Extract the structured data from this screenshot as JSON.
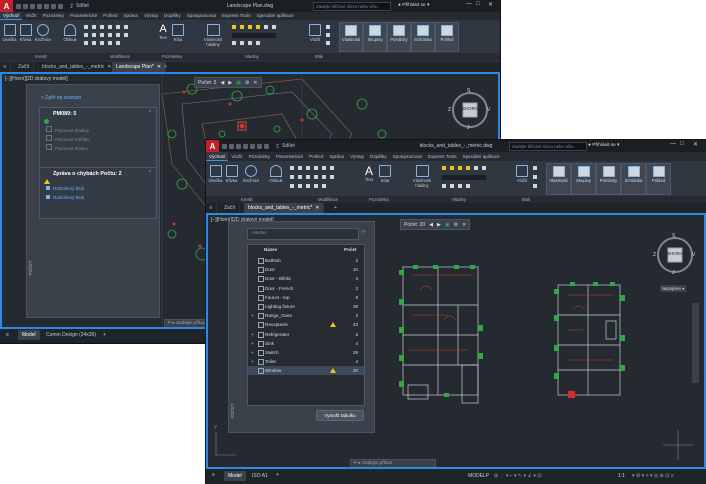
{
  "back_window": {
    "doc_title": "Landscape Plan.dwg",
    "share_label": "Sdílet",
    "search_placeholder": "Zadejte klíčové slovo nebo větu",
    "login_label": "Přihlásit se",
    "menu": [
      "Výchozí",
      "Vložit",
      "Poznámky",
      "Parametrické",
      "Pohled",
      "Správa",
      "Výstup",
      "Doplňky",
      "Spolupracovat",
      "Express Tools",
      "Speciální aplikace"
    ],
    "ribbon_tools": [
      "Úsečka",
      "Křivka",
      "Kružnice",
      "Oblouk",
      "Text",
      "Kóta",
      "Vlastnosti hladiny",
      "Vložit",
      "Vlastnosti",
      "Skupiny",
      "Pomůcky",
      "Schránka",
      "Pohled"
    ],
    "panel_labels": [
      "Kreslit",
      "Modifikace",
      "Poznámka",
      "Hladiny",
      "Blok"
    ],
    "tabs": [
      "Začít",
      "blocks_and_tables_-_metric",
      "Landscape Plan*"
    ],
    "viewport_label": "[−][Horní][2D drátový model]",
    "count_label": "Počet: 5",
    "viewcube": {
      "face": "SHORA",
      "s": "S",
      "j": "J",
      "z": "Z",
      "v": "V"
    },
    "count_palette": {
      "back": "< Zpět na seznam",
      "block_name": "PM089: 5",
      "options": [
        "Parovnat hladiny",
        "Parovnat měřítko",
        "Parovnat Rotaci"
      ],
      "error_title": "Zpráva o chybách Počtu: 2",
      "errors": [
        "Rozložený blok",
        "Rozložený blok"
      ],
      "side_label": "POČET"
    },
    "status": {
      "model_tab": "Model",
      "layout_tab": "Comm Design (24x36)"
    },
    "cmd_placeholder": "Zadejte příkaz"
  },
  "front_window": {
    "doc_title": "blocks_and_tables_-_metric.dwg",
    "share_label": "Sdílet",
    "search_placeholder": "Zadejte klíčové slovo nebo větu",
    "login_label": "Přihlásit se",
    "menu": [
      "Výchozí",
      "Vložit",
      "Poznámky",
      "Parametrické",
      "Pohled",
      "Správa",
      "Výstup",
      "Doplňky",
      "Spolupracovat",
      "Express Tools",
      "Speciální aplikace"
    ],
    "ribbon_tools": [
      "Úsečka",
      "Křivka",
      "Kružnice",
      "Oblouk",
      "Text",
      "Kóta",
      "Vlastnosti hladiny",
      "Vložit",
      "Vlastnosti",
      "Skupiny",
      "Pomůcky",
      "Schránka",
      "Pohled"
    ],
    "panel_labels": [
      "Kreslit",
      "Modifikace",
      "Poznámka",
      "Hladiny",
      "Blok"
    ],
    "tabs": [
      "Začít",
      "blocks_and_tables_-_metric*"
    ],
    "viewport_label": "[−][Horní][2D drátový model]",
    "count_label": "Počet: 20",
    "viewcube": {
      "face": "SHORA",
      "s": "S",
      "j": "J",
      "z": "Z",
      "v": "V",
      "wcs": "Nepojmen"
    },
    "count_palette": {
      "search_placeholder": "Hledat",
      "col_name": "Název",
      "col_count": "Počet",
      "rows": [
        {
          "name": "Bathtub",
          "count": "2",
          "warn": false,
          "expand": false
        },
        {
          "name": "Door",
          "count": "10",
          "warn": false,
          "expand": false
        },
        {
          "name": "Door - Bifold",
          "count": "4",
          "warn": false,
          "expand": false
        },
        {
          "name": "Door - French",
          "count": "2",
          "warn": false,
          "expand": false
        },
        {
          "name": "Faucet - top",
          "count": "6",
          "warn": false,
          "expand": false
        },
        {
          "name": "Lighting fixture",
          "count": "28",
          "warn": false,
          "expand": false
        },
        {
          "name": "Range_Oven",
          "count": "2",
          "warn": false,
          "expand": true
        },
        {
          "name": "Receptacle",
          "count": "43",
          "warn": true,
          "expand": false
        },
        {
          "name": "Refrigerator",
          "count": "2",
          "warn": false,
          "expand": true
        },
        {
          "name": "Sink",
          "count": "4",
          "warn": false,
          "expand": true
        },
        {
          "name": "Switch",
          "count": "29",
          "warn": false,
          "expand": true
        },
        {
          "name": "Toilet",
          "count": "4",
          "warn": false,
          "expand": true
        },
        {
          "name": "Window",
          "count": "20",
          "warn": true,
          "expand": false,
          "selected": true
        }
      ],
      "create_table": "Vytvořit tabulku",
      "side_label": "POČET"
    },
    "status": {
      "model_tab": "Model",
      "layout_tab": "ISO A1",
      "modelp": "MODELP",
      "scale": "1:1"
    },
    "cmd_placeholder": "Zadejte příkaz"
  }
}
